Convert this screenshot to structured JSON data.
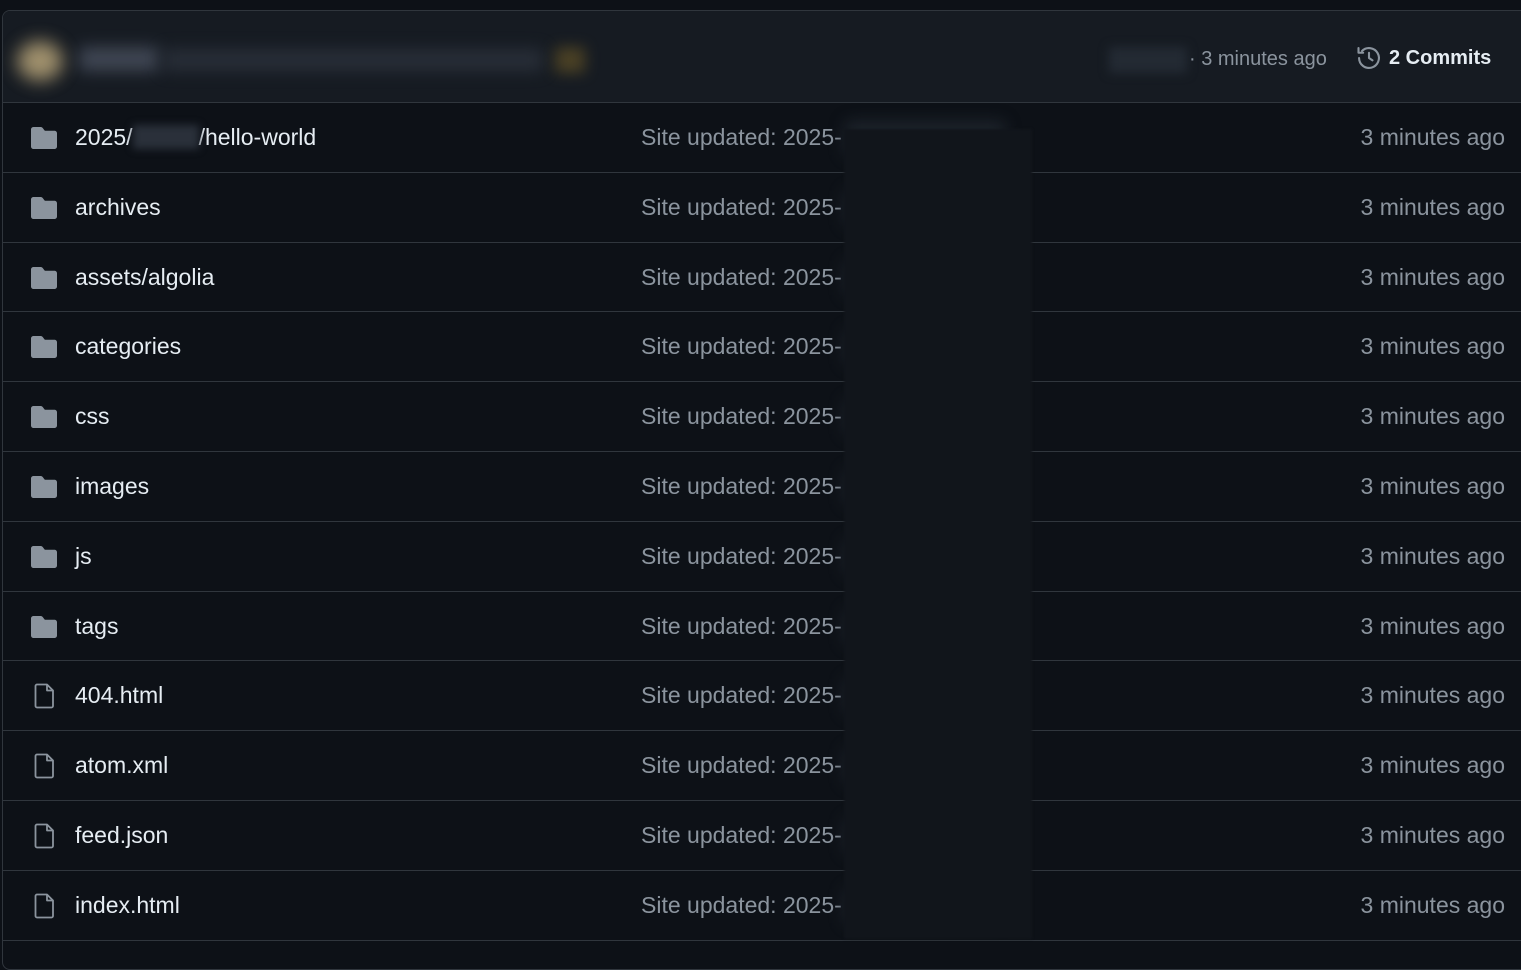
{
  "latest_commit": {
    "time": "· 3 minutes ago",
    "commits_label": "2 Commits"
  },
  "files": [
    {
      "type": "folder",
      "name_prefix": "2025/",
      "name_suffix": "/hello-world",
      "message": "Site updated: 2025-",
      "time": "3 minutes ago"
    },
    {
      "type": "folder",
      "name": "archives",
      "message": "Site updated: 2025-",
      "time": "3 minutes ago"
    },
    {
      "type": "folder",
      "name": "assets/algolia",
      "message": "Site updated: 2025-",
      "time": "3 minutes ago"
    },
    {
      "type": "folder",
      "name": "categories",
      "message": "Site updated: 2025-",
      "time": "3 minutes ago"
    },
    {
      "type": "folder",
      "name": "css",
      "message": "Site updated: 2025-",
      "time": "3 minutes ago"
    },
    {
      "type": "folder",
      "name": "images",
      "message": "Site updated: 2025-",
      "time": "3 minutes ago"
    },
    {
      "type": "folder",
      "name": "js",
      "message": "Site updated: 2025-",
      "time": "3 minutes ago"
    },
    {
      "type": "folder",
      "name": "tags",
      "message": "Site updated: 2025-",
      "time": "3 minutes ago"
    },
    {
      "type": "file",
      "name": "404.html",
      "message": "Site updated: 2025-",
      "time": "3 minutes ago"
    },
    {
      "type": "file",
      "name": "atom.xml",
      "message": "Site updated: 2025-",
      "time": "3 minutes ago"
    },
    {
      "type": "file",
      "name": "feed.json",
      "message": "Site updated: 2025-",
      "time": "3 minutes ago"
    },
    {
      "type": "file",
      "name": "index.html",
      "message": "Site updated: 2025-",
      "time": "3 minutes ago"
    }
  ],
  "colors": {
    "background": "#0d1117",
    "header_background": "#161b22",
    "border": "#30363d",
    "text_primary": "#e6edf3",
    "text_muted": "#8b949e",
    "icon": "#8b949e"
  },
  "icons": {
    "folder": "folder-icon",
    "file": "file-icon",
    "history": "history-icon"
  }
}
